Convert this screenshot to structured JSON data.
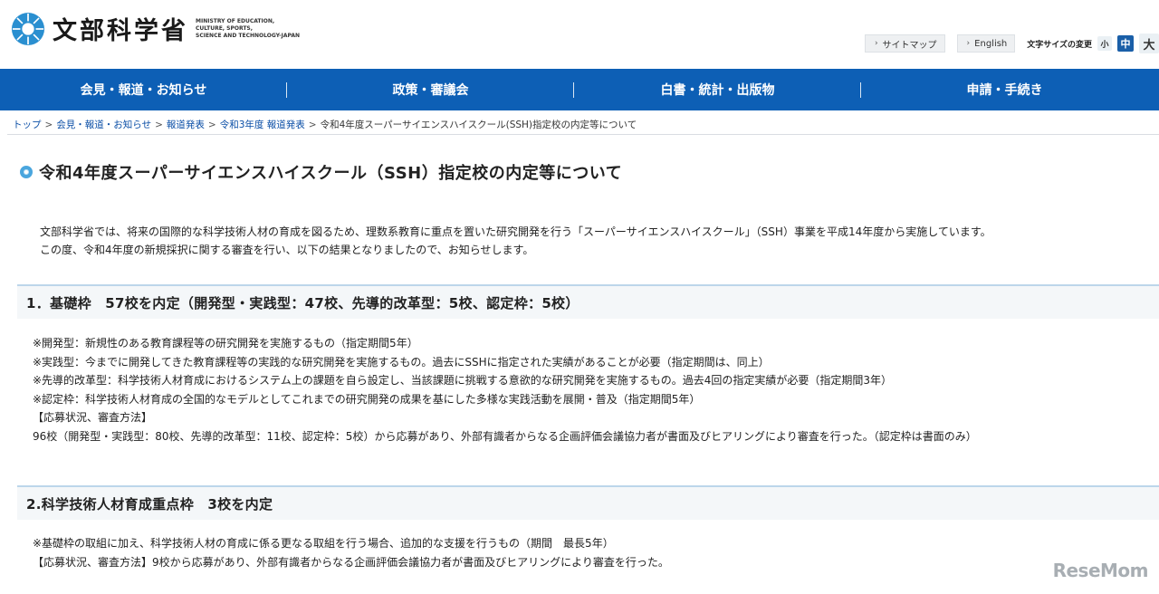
{
  "header": {
    "logo_jp": "文部科学省",
    "logo_en": [
      "MINISTRY OF EDUCATION,",
      "CULTURE, SPORTS,",
      "SCIENCE AND TECHNOLOGY-JAPAN"
    ],
    "links": [
      {
        "label": "サイトマップ",
        "icon": "chevron-right-icon"
      },
      {
        "label": "English",
        "icon": "chevron-right-icon"
      }
    ],
    "font_size_label": "文字サイズの変更",
    "font_sizes": {
      "small": "小",
      "medium": "中",
      "large": "大"
    }
  },
  "nav": {
    "items": [
      {
        "label": "会見・報道・お知らせ"
      },
      {
        "label": "政策・審議会"
      },
      {
        "label": "白書・統計・出版物"
      },
      {
        "label": "申請・手続き"
      }
    ]
  },
  "breadcrumb": {
    "items": [
      {
        "label": "トップ",
        "link": true
      },
      {
        "label": "会見・報道・お知らせ",
        "link": true
      },
      {
        "label": "報道発表",
        "link": true
      },
      {
        "label": "令和3年度 報道発表",
        "link": true
      },
      {
        "label": "令和4年度スーパーサイエンスハイスクール(SSH)指定校の内定等について",
        "link": false
      }
    ],
    "separator": ">"
  },
  "page": {
    "title": "令和4年度スーパーサイエンスハイスクール（SSH）指定校の内定等について",
    "intro": [
      "文部科学省では、将来の国際的な科学技術人材の育成を図るため、理数系教育に重点を置いた研究開発を行う「スーパーサイエンスハイスクール」（SSH）事業を平成14年度から実施しています。",
      "この度、令和4年度の新規採択に関する審査を行い、以下の結果となりましたので、お知らせします。"
    ]
  },
  "sections": [
    {
      "heading": "1．基礎枠　57校を内定（開発型・実践型：47校、先導的改革型：5校、認定枠：5校）",
      "lines": [
        "※開発型：新規性のある教育課程等の研究開発を実施するもの（指定期間5年）",
        "※実践型：今までに開発してきた教育課程等の実践的な研究開発を実施するもの。過去にSSHに指定された実績があることが必要（指定期間は、同上）",
        "※先導的改革型：科学技術人材育成におけるシステム上の課題を自ら設定し、当該課題に挑戦する意欲的な研究開発を実施するもの。過去4回の指定実績が必要（指定期間3年）",
        "※認定枠：科学技術人材育成の全国的なモデルとしてこれまでの研究開発の成果を基にした多様な実践活動を展開・普及（指定期間5年）",
        "【応募状況、審査方法】",
        "96校（開発型・実践型：80校、先導的改革型：11校、認定枠：5校）から応募があり、外部有識者からなる企画評価会議協力者が書面及びヒアリングにより審査を行った。（認定枠は書面のみ）"
      ]
    },
    {
      "heading": "2.科学技術人材育成重点枠　3校を内定",
      "lines": [
        "※基礎枠の取組に加え、科学技術人材の育成に係る更なる取組を行う場合、追加的な支援を行うもの（期間　最長5年）",
        "【応募状況、審査方法】9校から応募があり、外部有識者からなる企画評価会議協力者が書面及びヒアリングにより審査を行った。"
      ]
    }
  ],
  "watermark": "ReseMom",
  "colors": {
    "nav_bg": "#0d5fb5",
    "link": "#0a4ea6",
    "title_mark": "#4aa6de",
    "section_bg": "#f4f7f9"
  }
}
